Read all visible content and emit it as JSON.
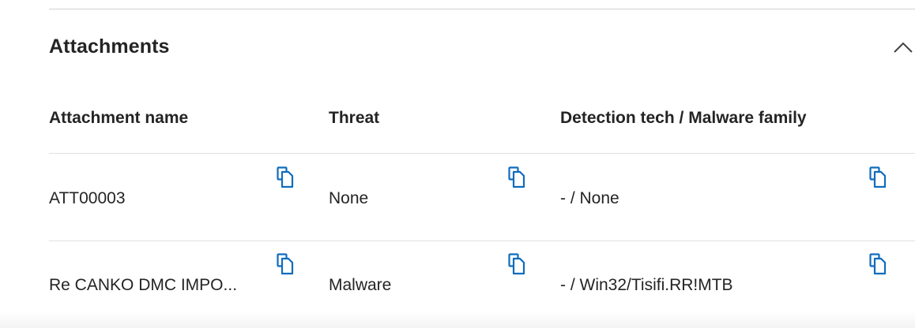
{
  "section": {
    "title": "Attachments",
    "collapse_icon": "chevron-up-icon"
  },
  "table": {
    "columns": [
      "Attachment name",
      "Threat",
      "Detection tech / Malware family"
    ],
    "rows": [
      [
        "ATT00003",
        "None",
        "- / None"
      ],
      [
        "Re CANKO DMC IMPO...",
        "Malware",
        "- / Win32/Tisifi.RR!MTB"
      ]
    ],
    "copy_icon": "copy-icon"
  },
  "colors": {
    "accent": "#0f6cbd",
    "text": "#242424",
    "divider": "#e1e1e1"
  }
}
